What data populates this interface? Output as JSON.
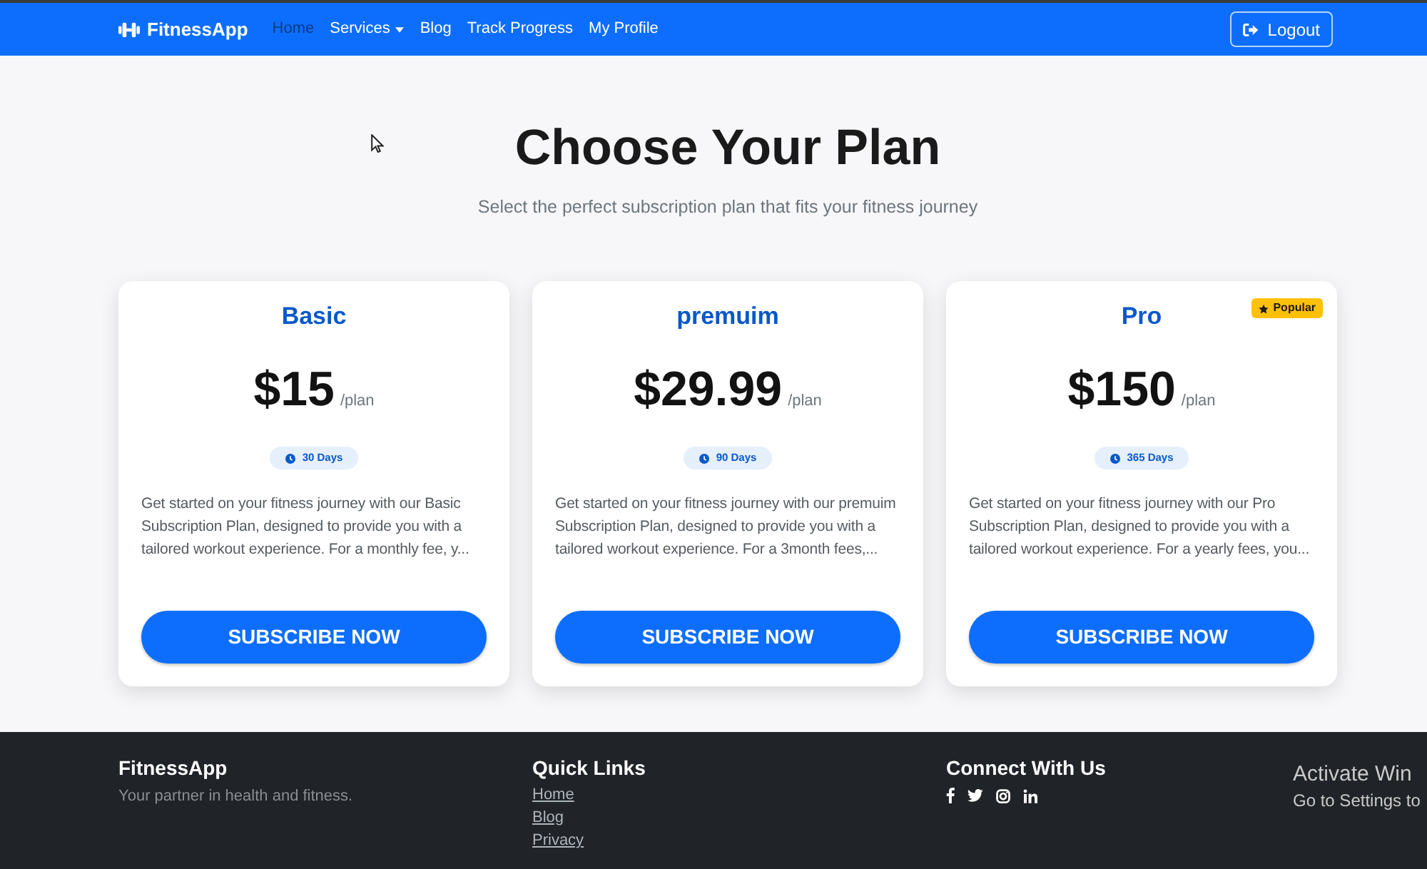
{
  "navbar": {
    "brand": "FitnessApp",
    "links": [
      {
        "label": "Home",
        "kind": "link",
        "selected": true
      },
      {
        "label": "Services",
        "kind": "dropdown",
        "selected": false
      },
      {
        "label": "Blog",
        "kind": "link",
        "selected": false
      },
      {
        "label": "Track Progress",
        "kind": "link",
        "selected": false
      },
      {
        "label": "My Profile",
        "kind": "link",
        "selected": false
      }
    ],
    "logout_button": "Logout"
  },
  "hero": {
    "title": "Choose Your Plan",
    "subtitle": "Select the perfect subscription plan that fits your fitness journey"
  },
  "plans": [
    {
      "name": "Basic",
      "price": "$15",
      "period": "/plan",
      "duration": "30 Days",
      "description": "Get started on your fitness journey with our Basic Subscription Plan, designed to provide you with a tailored workout experience. For a monthly fee, y...",
      "button": "SUBSCRIBE NOW"
    },
    {
      "name": "premuim",
      "price": "$29.99",
      "period": "/plan",
      "duration": "90 Days",
      "description": "Get started on your fitness journey with our premuim Subscription Plan, designed to provide you with a tailored workout experience. For a 3month fees,...",
      "button": "SUBSCRIBE NOW"
    },
    {
      "name": "Pro",
      "price": "$150",
      "period": "/plan",
      "duration": "365 Days",
      "description": "Get started on your fitness journey with our Pro Subscription Plan, designed to provide you with a tailored workout experience. For a yearly fees, you...",
      "button": "SUBSCRIBE NOW",
      "badge": "Popular"
    }
  ],
  "footer": {
    "about": {
      "title": "FitnessApp",
      "tagline": "Your partner in health and fitness."
    },
    "quick_links": {
      "title": "Quick Links",
      "links": [
        "Home",
        "Blog",
        "Privacy"
      ]
    },
    "connect": {
      "title": "Connect With Us"
    }
  },
  "os_overlay": {
    "title": "Activate Win",
    "subtitle": "Go to Settings to"
  }
}
